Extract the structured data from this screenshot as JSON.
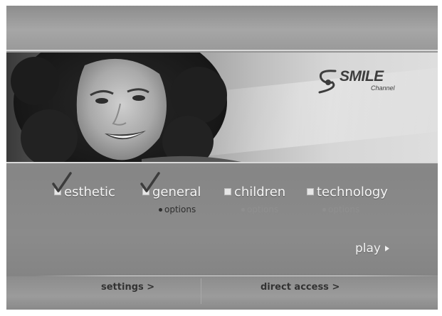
{
  "banner": {
    "logo": {
      "word": "SMILE",
      "sub": "Channel"
    }
  },
  "categories": [
    {
      "label": "esthetic",
      "checked": true
    },
    {
      "label": "general",
      "checked": true
    },
    {
      "label": "children",
      "checked": false
    },
    {
      "label": "technology",
      "checked": false
    }
  ],
  "options": [
    {
      "label": "options",
      "state": "active"
    },
    {
      "label": "options",
      "state": "inactive"
    },
    {
      "label": "options",
      "state": "inactive"
    }
  ],
  "play": {
    "label": "play",
    "icon": "play-arrow-icon"
  },
  "bottom": {
    "settings_label": "settings >",
    "direct_access_label": "direct access >"
  },
  "colors": {
    "check": "#3c3c3c",
    "label": "#f4f4f4",
    "options_active": "#2e2e2e",
    "options_inactive": "#8f8f8f"
  }
}
